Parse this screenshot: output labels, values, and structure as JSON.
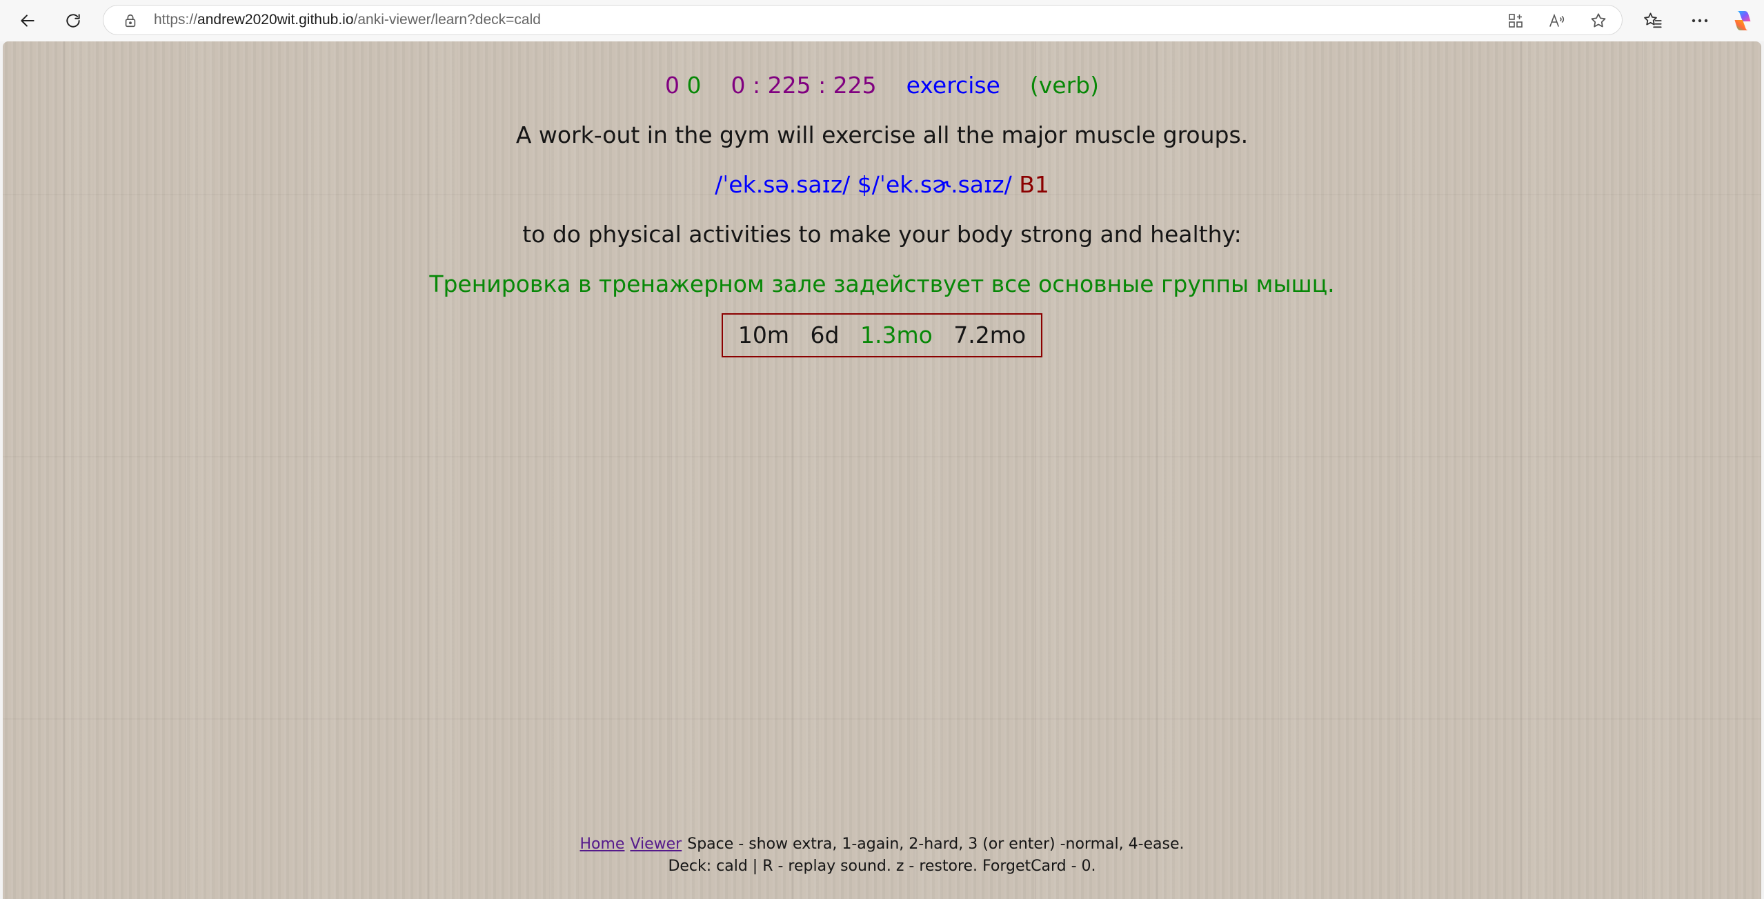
{
  "browser": {
    "url_prefix": "https://",
    "url_host": "andrew2020wit.github.io",
    "url_path": "/anki-viewer/learn?deck=cald"
  },
  "card": {
    "counts": {
      "new": "0",
      "learn": "0",
      "review": "0 : 225 : 225"
    },
    "word": "exercise",
    "part_of_speech": "(verb)",
    "example": "A work-out in the gym will exercise all the major muscle groups.",
    "pronunciation": "/ˈek.sə.saɪz/ $/ˈek.sɚ.saɪz/",
    "level": "B1",
    "definition": "to do physical activities to make your body strong and healthy:",
    "translation": "Тренировка в тренажерном зале задействует все основные группы мышц.",
    "answers": {
      "again": "10m",
      "hard": "6d",
      "normal": "1.3mo",
      "easy": "7.2mo"
    }
  },
  "footer": {
    "home_link": "Home",
    "viewer_link": "Viewer",
    "help_line1": "Space - show extra, 1-again, 2-hard, 3 (or enter) -normal, 4-ease.",
    "help_line2": "Deck: cald | R - replay sound. z - restore. ForgetCard - 0."
  },
  "colors": {
    "counts": "#800080",
    "word": "#0000ff",
    "part_of_speech": "#078807",
    "level": "#8b0000",
    "translation": "#078807",
    "answer_border": "#8b0000"
  },
  "icons": [
    "back-arrow-icon",
    "refresh-icon",
    "lock-icon",
    "app-available-icon",
    "read-aloud-icon",
    "favorite-star-icon",
    "favorites-icon",
    "more-icon",
    "copilot-icon"
  ]
}
